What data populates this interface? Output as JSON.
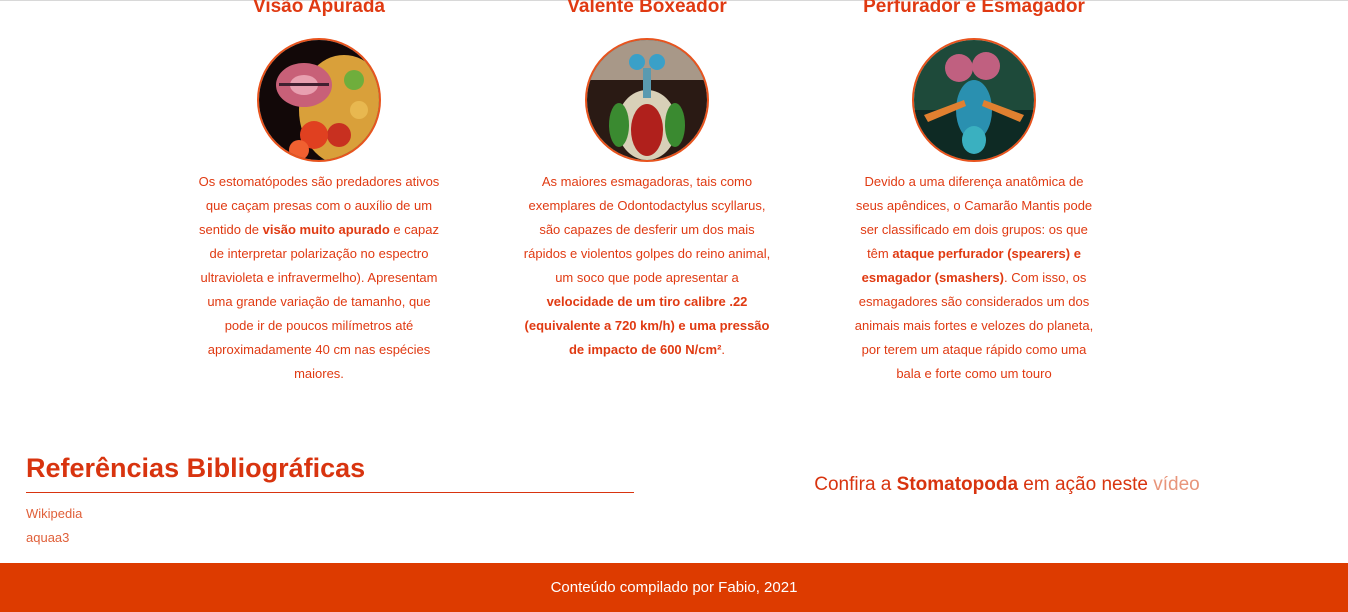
{
  "cards": [
    {
      "title": "Visão Apurada",
      "image_alt": "mantis-shrimp-eye-closeup",
      "text": [
        {
          "t": "Os estomatópodes são predadores ativos que caçam presas com o auxílio de um sentido de ",
          "b": false
        },
        {
          "t": "visão muito apurado",
          "b": true
        },
        {
          "t": " e capaz de interpretar polarização no espectro ultravioleta e infravermelho). Apresentam uma grande variação de tamanho, que pode ir de poucos milímetros até aproximadamente 40 cm nas espécies maiores.",
          "b": false
        }
      ]
    },
    {
      "title": "Valente Boxeador",
      "image_alt": "mantis-shrimp-front-view",
      "text": [
        {
          "t": "As maiores esmagadoras, tais como exemplares de Odontodactylus scyllarus, são capazes de desferir um dos mais rápidos e violentos golpes do reino animal, um soco que pode apresentar a ",
          "b": false
        },
        {
          "t": "velocidade de um tiro calibre .22 (equivalente a 720 km/h) e uma pressão de impacto de 600 N/cm²",
          "b": true
        },
        {
          "t": ".",
          "b": false
        }
      ]
    },
    {
      "title": "Perfurador e Esmagador",
      "image_alt": "mantis-shrimp-colorful",
      "text": [
        {
          "t": "Devido a uma diferença anatômica de seus apêndices, o Camarão Mantis pode ser classificado em dois grupos: os que têm ",
          "b": false
        },
        {
          "t": "ataque perfurador (spearers) e esmagador (smashers)",
          "b": true
        },
        {
          "t": ". Com isso, os esmagadores são considerados um dos animais mais fortes e velozes do planeta, por terem um ataque rápido como uma bala e forte como um touro",
          "b": false
        }
      ]
    }
  ],
  "references": {
    "title": "Referências Bibliográficas",
    "links": [
      "Wikipedia",
      "aquaa3"
    ]
  },
  "video_cta": {
    "prefix": "Confira a ",
    "bold": "Stomatopoda",
    "middle": " em ação neste ",
    "link": "vídeo"
  },
  "footer": {
    "text": "Conteúdo compilado por Fabio, 2021"
  },
  "colors": {
    "accent": "#e03a12",
    "footer_bg": "#dd3b00",
    "link_light": "#e8957a"
  }
}
